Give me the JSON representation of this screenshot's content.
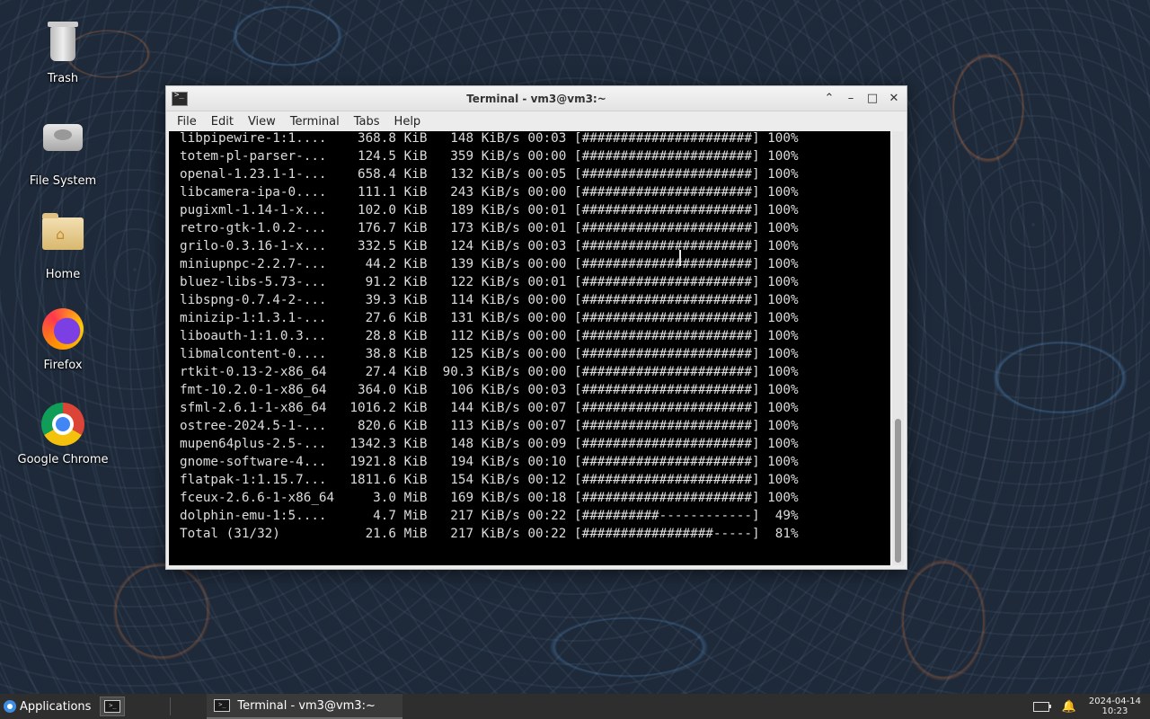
{
  "desktop": {
    "icons": [
      {
        "label": "Trash",
        "icon": "trash-icon"
      },
      {
        "label": "File System",
        "icon": "drive-icon"
      },
      {
        "label": "Home",
        "icon": "home-folder-icon"
      },
      {
        "label": "Firefox",
        "icon": "firefox-icon"
      },
      {
        "label": "Google Chrome",
        "icon": "chrome-icon"
      }
    ]
  },
  "window": {
    "title": "Terminal - vm3@vm3:~",
    "menu": [
      "File",
      "Edit",
      "View",
      "Terminal",
      "Tabs",
      "Help"
    ],
    "buttons": {
      "shade": "⌃",
      "minimize": "–",
      "maximize": "□",
      "close": "✕"
    }
  },
  "terminal": {
    "lines": [
      "libpipewire-1:1....    368.8 KiB   148 KiB/s 00:03 [######################] 100%",
      "totem-pl-parser-...    124.5 KiB   359 KiB/s 00:00 [######################] 100%",
      "openal-1.23.1-1-...    658.4 KiB   132 KiB/s 00:05 [######################] 100%",
      "libcamera-ipa-0....    111.1 KiB   243 KiB/s 00:00 [######################] 100%",
      "pugixml-1.14-1-x...    102.0 KiB   189 KiB/s 00:01 [######################] 100%",
      "retro-gtk-1.0.2-...    176.7 KiB   173 KiB/s 00:01 [######################] 100%",
      "grilo-0.3.16-1-x...    332.5 KiB   124 KiB/s 00:03 [######################] 100%",
      "miniupnpc-2.2.7-...     44.2 KiB   139 KiB/s 00:00 [######################] 100%",
      "bluez-libs-5.73-...     91.2 KiB   122 KiB/s 00:01 [######################] 100%",
      "libspng-0.7.4-2-...     39.3 KiB   114 KiB/s 00:00 [######################] 100%",
      "minizip-1:1.3.1-...     27.6 KiB   131 KiB/s 00:00 [######################] 100%",
      "liboauth-1:1.0.3...     28.8 KiB   112 KiB/s 00:00 [######################] 100%",
      "libmalcontent-0....     38.8 KiB   125 KiB/s 00:00 [######################] 100%",
      "rtkit-0.13-2-x86_64     27.4 KiB  90.3 KiB/s 00:00 [######################] 100%",
      "fmt-10.2.0-1-x86_64    364.0 KiB   106 KiB/s 00:03 [######################] 100%",
      "sfml-2.6.1-1-x86_64   1016.2 KiB   144 KiB/s 00:07 [######################] 100%",
      "ostree-2024.5-1-...    820.6 KiB   113 KiB/s 00:07 [######################] 100%",
      "mupen64plus-2.5-...   1342.3 KiB   148 KiB/s 00:09 [######################] 100%",
      "gnome-software-4...   1921.8 KiB   194 KiB/s 00:10 [######################] 100%",
      "flatpak-1:1.15.7...   1811.6 KiB   154 KiB/s 00:12 [######################] 100%",
      "fceux-2.6.6-1-x86_64     3.0 MiB   169 KiB/s 00:18 [######################] 100%",
      "dolphin-emu-1:5....      4.7 MiB   217 KiB/s 00:22 [##########------------]  49%",
      "Total (31/32)           21.6 MiB   217 KiB/s 00:22 [#################-----]  81%"
    ]
  },
  "taskbar": {
    "applications_label": "Applications",
    "task_label": "Terminal - vm3@vm3:~",
    "date": "2024-04-14",
    "time": "10:23"
  }
}
